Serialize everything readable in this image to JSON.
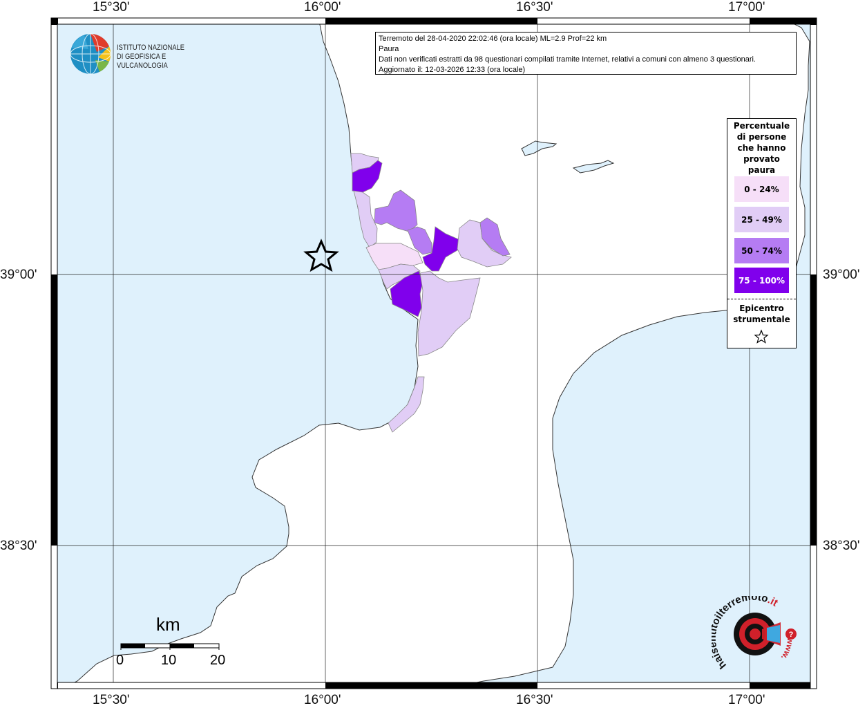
{
  "map": {
    "colors": {
      "sea": "#dff1fc",
      "land": "#ffffff",
      "class_0_24": "#f6dff8",
      "class_25_49": "#e1cdf6",
      "class_50_74": "#b57cf3",
      "class_75_100": "#8000ec"
    },
    "ticks_top": [
      "15°30'",
      "16°00'",
      "16°30'",
      "17°00'"
    ],
    "ticks_bottom": [
      "15°30'",
      "16°00'",
      "16°30'",
      "17°00'"
    ],
    "ticks_left": [
      "39°00'",
      "38°30'"
    ],
    "ticks_right": [
      "39°00'",
      "38°30'"
    ]
  },
  "info": {
    "line1": "Terremoto del 28-04-2020 22:02:46 (ora locale) ML=2.9 Prof=22 km",
    "line2": "Paura",
    "line3": "Dati non verificati estratti da 98 questionari compilati tramite Internet, relativi a comuni con almeno 3 questionari.",
    "line4": "Aggiornato il: 12-03-2026 12:33 (ora locale)"
  },
  "legend": {
    "title_lines": [
      "Percentuale",
      "di persone",
      "che hanno",
      "provato",
      "paura"
    ],
    "classes": [
      {
        "label": "0 - 24%",
        "color": "#f6dff8",
        "text_color": "#000000"
      },
      {
        "label": "25 - 49%",
        "color": "#e1cdf6",
        "text_color": "#000000"
      },
      {
        "label": "50 - 74%",
        "color": "#b57cf3",
        "text_color": "#000000"
      },
      {
        "label": "75 - 100%",
        "color": "#8000ec",
        "text_color": "#ffffff"
      }
    ],
    "epicenter_lines": [
      "Epicentro",
      "strumentale"
    ],
    "epicenter_icon": "star-icon"
  },
  "logo": {
    "line1": "ISTITUTO NAZIONALE",
    "line2": "DI GEOFISICA E VULCANOLOGIA"
  },
  "scale": {
    "unit": "km",
    "labels": [
      "0",
      "10",
      "20"
    ]
  },
  "site_logo": {
    "text_main": "haisentitoilterremoto",
    "text_tld": ".it",
    "text_www": "www."
  }
}
